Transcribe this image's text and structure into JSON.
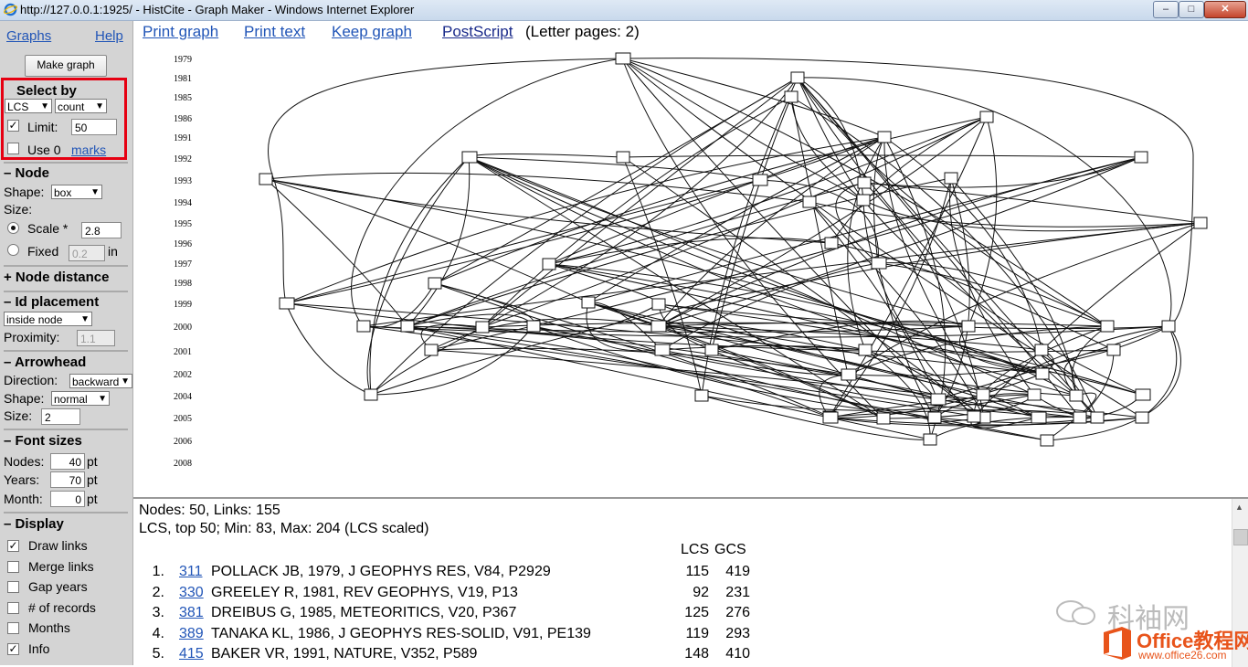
{
  "window": {
    "title": "http://127.0.0.1:1925/ - HistCite - Graph Maker - Windows Internet Explorer"
  },
  "sidebar": {
    "graphs_link": "Graphs",
    "help_link": "Help",
    "make_graph_button": "Make graph",
    "select_by": {
      "heading": "Select by",
      "field": "LCS",
      "mode": "count",
      "limit_label": "Limit:",
      "limit_value": "50",
      "limit_checked": true,
      "use_label": "Use 0",
      "marks_link": "marks"
    },
    "node": {
      "heading": "– Node",
      "shape_label": "Shape:",
      "shape_value": "box",
      "size_label": "Size:",
      "scale_label": "Scale *",
      "scale_value": "2.8",
      "fixed_label": "Fixed",
      "fixed_value": "0.2",
      "fixed_unit": "in"
    },
    "node_distance": {
      "heading": "+ Node distance"
    },
    "id_placement": {
      "heading": "– Id placement",
      "value": "inside node",
      "proximity_label": "Proximity:",
      "proximity_value": "1.1"
    },
    "arrowhead": {
      "heading": "– Arrowhead",
      "direction_label": "Direction:",
      "direction_value": "backward",
      "shape_label": "Shape:",
      "shape_value": "normal",
      "size_label": "Size:",
      "size_value": "2"
    },
    "font_sizes": {
      "heading": "– Font sizes",
      "nodes_label": "Nodes:",
      "nodes_value": "40",
      "years_label": "Years:",
      "years_value": "70",
      "month_label": "Month:",
      "month_value": "0",
      "unit": "pt"
    },
    "display": {
      "heading": "– Display",
      "options": [
        {
          "label": "Draw links",
          "checked": true
        },
        {
          "label": "Merge links",
          "checked": false
        },
        {
          "label": "Gap years",
          "checked": false
        },
        {
          "label": "# of records",
          "checked": false
        },
        {
          "label": "Months",
          "checked": false
        },
        {
          "label": "Info",
          "checked": true
        }
      ]
    }
  },
  "toolbar": {
    "print_graph": "Print graph",
    "print_text": "Print text",
    "keep_graph": "Keep graph",
    "postscript": "PostScript",
    "letter_pages": "(Letter pages: 2)"
  },
  "graph": {
    "years": [
      "1979",
      "1981",
      "1985",
      "1986",
      "1991",
      "1992",
      "1993",
      "1994",
      "1995",
      "1996",
      "1997",
      "1998",
      "1999",
      "2000",
      "2001",
      "2002",
      "2004",
      "2005",
      "2006",
      "2008"
    ]
  },
  "info": {
    "line1": "Nodes: 50, Links: 155",
    "line2": "LCS, top 50; Min: 83, Max: 204 (LCS scaled)",
    "col_lcs": "LCS",
    "col_gcs": "GCS",
    "records": [
      {
        "rank": "1.",
        "id": "311",
        "text": "POLLACK JB, 1979, J GEOPHYS RES, V84, P2929",
        "lcs": "115",
        "gcs": "419"
      },
      {
        "rank": "2.",
        "id": "330",
        "text": "GREELEY R, 1981, REV GEOPHYS, V19, P13",
        "lcs": "92",
        "gcs": "231"
      },
      {
        "rank": "3.",
        "id": "381",
        "text": "DREIBUS G, 1985, METEORITICS, V20, P367",
        "lcs": "125",
        "gcs": "276"
      },
      {
        "rank": "4.",
        "id": "389",
        "text": "TANAKA KL, 1986, J GEOPHYS RES-SOLID, V91, PE139",
        "lcs": "119",
        "gcs": "293"
      },
      {
        "rank": "5.",
        "id": "415",
        "text": "BAKER VR, 1991, NATURE, V352, P589",
        "lcs": "148",
        "gcs": "410"
      }
    ]
  },
  "watermark": {
    "brand1": "科袖网",
    "brand2": "Office教程网",
    "url": "www.office26.com"
  },
  "colors": {
    "link": "#2155b7",
    "highlight": "#e60012",
    "sidebar": "#d4d4d4"
  }
}
